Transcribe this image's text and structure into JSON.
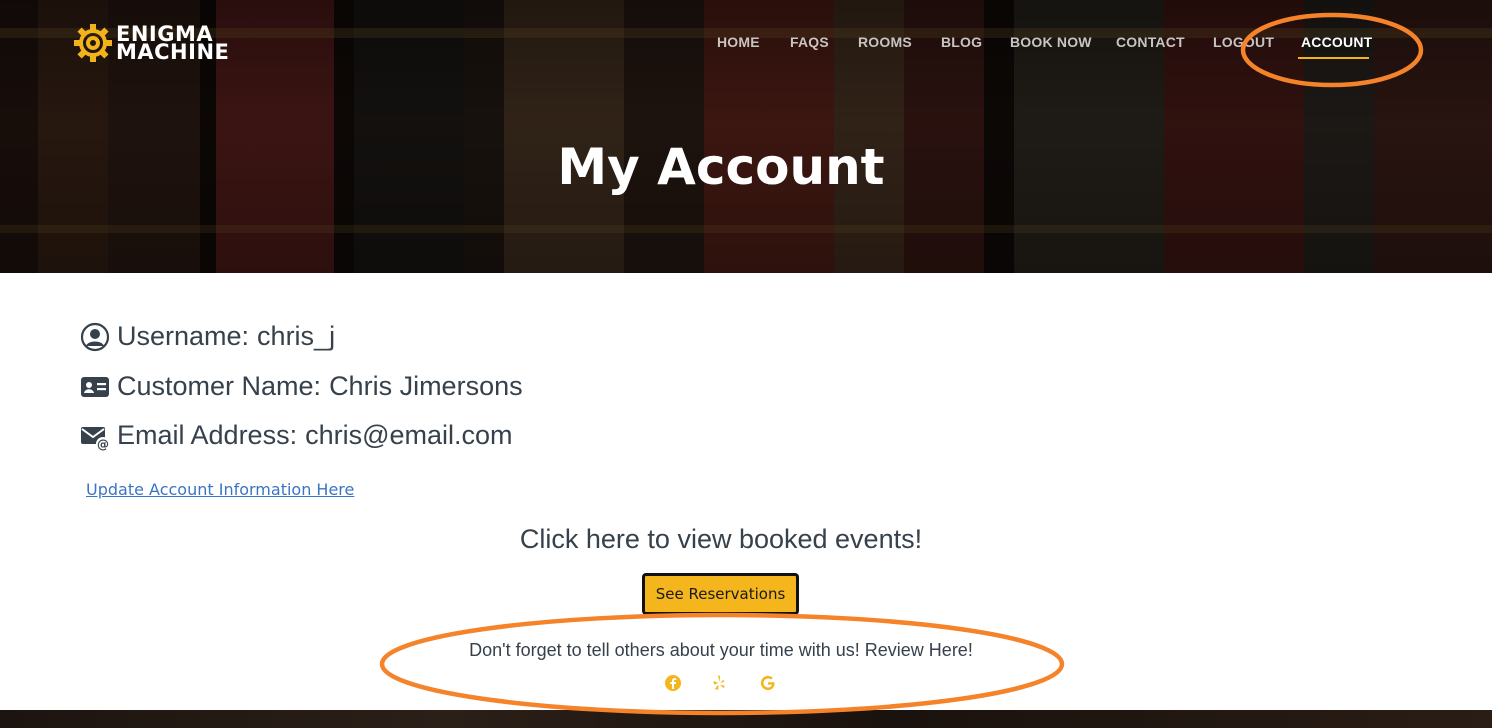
{
  "brand": {
    "line1": "ENIGMA",
    "line2": "MACHINE",
    "icon": "gear-icon",
    "accent_color": "#f2b21c"
  },
  "nav": {
    "items": [
      {
        "label": "HOME"
      },
      {
        "label": "FAQS"
      },
      {
        "label": "ROOMS"
      },
      {
        "label": "BLOG"
      },
      {
        "label": "BOOK NOW"
      },
      {
        "label": "CONTACT"
      },
      {
        "label": "LOGOUT"
      },
      {
        "label": "ACCOUNT",
        "active": true
      }
    ]
  },
  "hero": {
    "title": "My Account"
  },
  "account": {
    "username": {
      "label": "Username:",
      "value": "chris_j",
      "icon": "user-circle-icon"
    },
    "customer_name": {
      "label": "Customer Name:",
      "value": "Chris Jimersons",
      "icon": "id-card-icon"
    },
    "email": {
      "label": "Email Address:",
      "value": "chris@email.com",
      "icon": "envelope-at-icon"
    },
    "update_link": "Update Account Information Here"
  },
  "reservations": {
    "prompt": "Click here to view booked events!",
    "button_label": "See Reservations",
    "button_color": "#f5b51c"
  },
  "review": {
    "prompt": "Don't forget to tell others about your time with us! Review Here!",
    "links": [
      "facebook-icon",
      "yelp-icon",
      "google-icon"
    ]
  },
  "annotation_color": "#f5832a"
}
